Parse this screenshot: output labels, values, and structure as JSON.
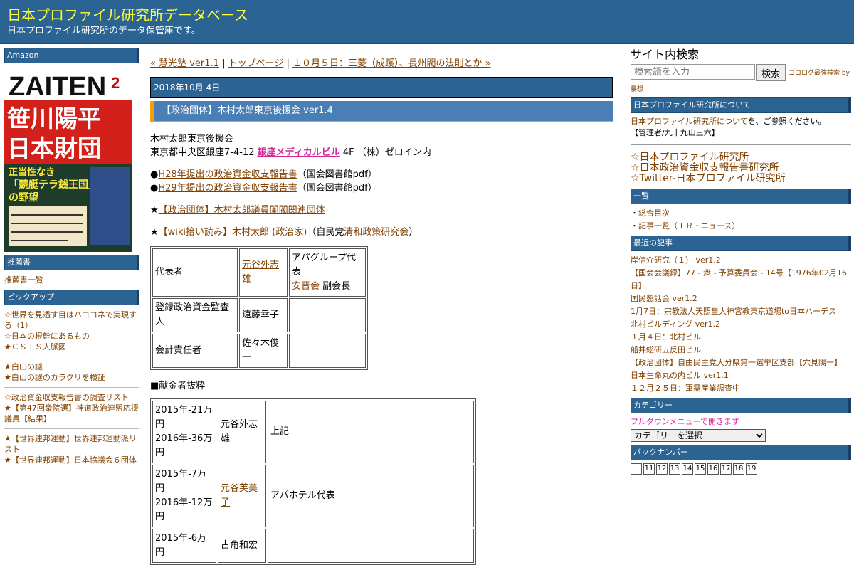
{
  "header": {
    "title": "日本プロファイル研究所データベース",
    "description": "日本プロファイル研究所のデータ保管庫です。"
  },
  "left": {
    "amazon_title": "Amazon",
    "magazine": {
      "title": "ZAITEN",
      "issue": "2",
      "headline1": "笹川陽平",
      "headline2": "日本財団",
      "sub1": "正当性なき",
      "sub2": "「競艇テラ銭王国」",
      "sub3": "の野望"
    },
    "recommend_title": "推薦書",
    "recommend_link": "推薦書一覧",
    "pickup_title": "ピックアップ",
    "pickup_groups": [
      [
        "☆世界を見透す目はハココネで実現する（1）",
        "☆日本の根幹にあるもの",
        "★ＣＳＩＳ人脈図"
      ],
      [
        "★白山の謎",
        "★白山の謎のカラクリを検証"
      ],
      [
        "☆政治資金収支報告書の調査リスト",
        "★【第47回衆院選】神道政治連盟応援議員【結果】"
      ],
      [
        "★【世界連邦運動】世界連邦運動派リスト",
        "★【世界連邦運動】日本協議会６団体"
      ]
    ]
  },
  "center": {
    "nav": {
      "prev": "« 慧光塾 ver1.1",
      "sep": " | ",
      "top": "トップページ",
      "next": "１０月５日：三菱（成蹊）、長州閥の法則とか »"
    },
    "date": "2018年10月 4日",
    "entry_title": "【政治団体】木村太郎東京後援会 ver1.4",
    "org_name": "木村太郎東京後援会",
    "address_pre": "東京都中央区銀座7-4-12 ",
    "address_link": "銀座メディカルビル",
    "address_post": " 4F （株）ゼロイン内",
    "report1_link": "H28年提出の政治資金収支報告書",
    "report1_post": "（国会図書館pdf）",
    "report2_link": "H29年提出の政治資金収支報告書",
    "report2_post": "（国会図書館pdf）",
    "related_link": "【政治団体】木村太郎議員閨閥関連団体",
    "wiki_link": "【wiki拾い読み】木村太郎 (政治家)",
    "wiki_mid": "（自民党",
    "wiki_party_link": "清和政策研究会",
    "wiki_end": "）",
    "info_table": {
      "r1_label": "代表者",
      "r1_name": "元谷外志雄",
      "r1_note1": "アパグループ代表",
      "r1_note2_link": "安晋会",
      "r1_note2_post": " 副会長",
      "r2_label": "登録政治資金監査人",
      "r2_name": "遠藤幸子",
      "r3_label": "会計責任者",
      "r3_name": "佐々木俊一"
    },
    "donor_head": "■献金者抜粋",
    "donors": [
      {
        "amount1": "2015年-21万円",
        "amount2": "2016年-36万円",
        "name": "元谷外志雄",
        "note": "上記"
      },
      {
        "amount1": "2015年-7万円",
        "amount2": "2016年-12万円",
        "name": "元谷芙美子",
        "note": "アパホテル代表"
      },
      {
        "amount1": "2015年-6万円",
        "amount2": "",
        "name": "古角和宏",
        "note": ""
      }
    ]
  },
  "right": {
    "search_head": "サイト内検索",
    "search_placeholder": "検索語を入力",
    "search_button": "検索",
    "search_note": "ココログ最強検索 by",
    "search_note2": "暴想",
    "about_title": "日本プロファイル研究所について",
    "about_link": "日本プロファイル研究所について",
    "about_text": "を、ご参照ください。",
    "admin": "【管理者/九十九山三六】",
    "big_links": [
      "☆日本プロファイル研究所",
      "☆日本政治資金収支報告書研究所",
      "☆Twitter-日本プロファイル研究所"
    ],
    "list_title": "一覧",
    "list_items": [
      "総合目次",
      "記事一覧（ＩＲ・ニュース）"
    ],
    "recent_title": "最近の記事",
    "recent_items": [
      "岸信介研究（１） ver1.2",
      "【国会会議録】77 - 衆 - 予算委員会 - 14号【1976年02月16日】",
      "国民懇話会 ver1.2",
      "1月7日：宗教法人天照皇大神宮教東京道場to日本ハーデス",
      "北村ビルディング ver1.2",
      "１月４日：北村ビル",
      "船井総研五反田ビル",
      "【政治団体】自由民主党大分県第一選挙区支部【穴見陽一】",
      "日本生命丸の内ビル ver1.1",
      "１２月２５日：軍需産業調査中"
    ],
    "category_title": "カテゴリー",
    "category_note": "プルダウンメニューで開きます",
    "category_select": "カテゴリーを選択",
    "backnumber_title": "バックナンバー",
    "backnumbers": [
      "",
      "11",
      "12",
      "13",
      "14",
      "15",
      "16",
      "17",
      "18",
      "19"
    ]
  }
}
